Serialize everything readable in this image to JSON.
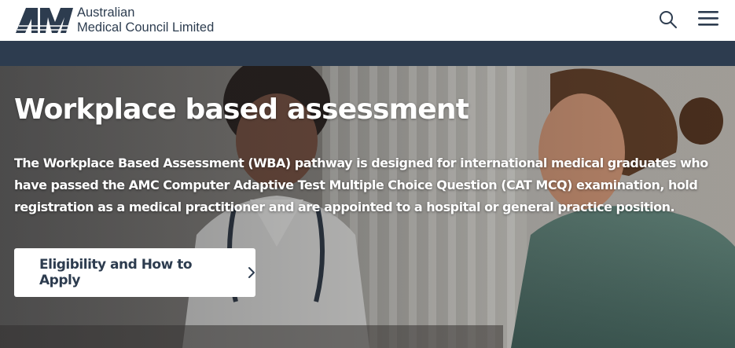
{
  "header": {
    "org_name_line1": "Australian",
    "org_name_line2": "Medical Council Limited",
    "logo_icon": "amc-logo-icon",
    "search_icon": "search-icon",
    "menu_icon": "hamburger-menu-icon"
  },
  "hero": {
    "title": "Workplace based assessment",
    "description": "The Workplace Based Assessment (WBA) pathway is designed for international medical graduates who have passed the AMC Computer Adaptive Test Multiple Choice Question (CAT MCQ) examination, hold registration as a medical practitioner and are appointed to a hospital or general practice position.",
    "cta_label": "Eligibility and How to Apply",
    "cta_icon": "chevron-right-icon"
  },
  "colors": {
    "brand_navy": "#2d3c4f",
    "cta_background": "#ffffff",
    "hero_text": "#ffffff"
  }
}
